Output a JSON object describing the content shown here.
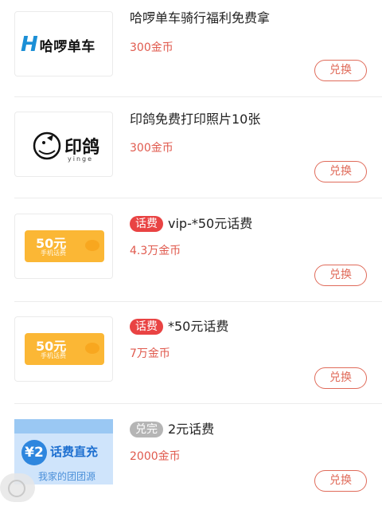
{
  "items": [
    {
      "title": "哈啰单车骑行福利免费拿",
      "tag": "",
      "price": "300金币",
      "button": "兑换",
      "logo_text": "哈啰单车",
      "logo_mark": "H"
    },
    {
      "title": "印鸽免费打印照片10张",
      "tag": "",
      "price": "300金币",
      "button": "兑换",
      "logo_text": "印鸽",
      "logo_sub": "yinge"
    },
    {
      "title": "vip-*50元话费",
      "tag": "话费",
      "price": "4.3万金币",
      "button": "兑换",
      "ticket_value": "50元",
      "ticket_sub": "手机话费"
    },
    {
      "title": "*50元话费",
      "tag": "话费",
      "price": "7万金币",
      "button": "兑换",
      "ticket_value": "50元",
      "ticket_sub": "手机话费"
    },
    {
      "title": "2元话费",
      "tag": "兑完",
      "price": "2000金币",
      "button": "兑换",
      "banner_amount": "¥2",
      "banner_text": "话费直充",
      "banner_sub": "我家的团团源"
    }
  ],
  "colors": {
    "accent": "#e06b5a",
    "tag_red": "#e94343",
    "tag_gray": "#b5b5b5",
    "price": "#e05a4e"
  }
}
